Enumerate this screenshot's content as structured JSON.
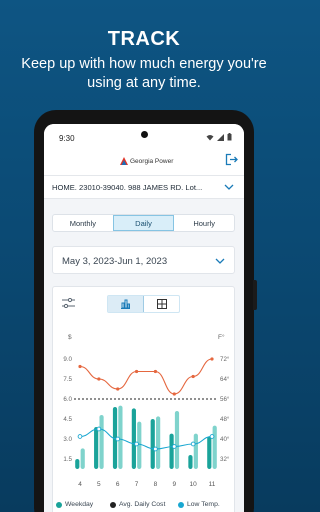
{
  "promo": {
    "title": "TRACK",
    "subtitle": "Keep up with how much energy you're using at any time."
  },
  "status_bar": {
    "time": "9:30"
  },
  "app": {
    "brand": "Georgia Power"
  },
  "account": {
    "address": "HOME. 23010-39040. 988 JAMES RD. Lot..."
  },
  "tabs": [
    {
      "label": "Monthly",
      "active": false
    },
    {
      "label": "Daily",
      "active": true
    },
    {
      "label": "Hourly",
      "active": false
    }
  ],
  "date_range": "May 3, 2023-Jun 1, 2023",
  "chart_data": {
    "type": "bar",
    "left_axis_unit": "$",
    "right_axis_unit": "F°",
    "left_ticks": [
      "9.0",
      "7.5",
      "6.0",
      "4.5",
      "3.0",
      "1.5"
    ],
    "right_ticks": [
      "72°",
      "64°",
      "56°",
      "48°",
      "40°",
      "32°"
    ],
    "ylim": [
      0.75,
      9.75
    ],
    "temp_ylim": [
      28,
      76
    ],
    "x_tick_labels": [
      "4",
      "5",
      "6",
      "7",
      "8",
      "9",
      "10",
      "11"
    ],
    "x": [
      4,
      5,
      6,
      7,
      8,
      9,
      10,
      11
    ],
    "series": [
      {
        "name": "Weekday",
        "values": [
          1.5,
          3.9,
          5.4,
          5.3,
          4.5,
          3.4,
          1.8,
          3.2
        ],
        "color": "#1aa39a"
      },
      {
        "name": "Weekday (lighter)",
        "values": [
          2.3,
          4.8,
          5.5,
          4.3,
          4.7,
          5.1,
          3.4,
          4.0
        ],
        "color": "#7fd3cc"
      }
    ],
    "avg_daily_cost": 6.0,
    "temperature_series": {
      "name": "Low Temp.",
      "values": [
        41,
        44,
        40,
        38,
        36,
        37,
        38,
        41
      ],
      "color": "#19a7d1"
    },
    "high_temp_series": {
      "values": [
        69,
        64,
        60,
        67,
        67,
        58,
        65,
        72
      ],
      "color": "#e5673f"
    }
  },
  "legend": [
    {
      "label": "Weekday",
      "color": "#1aa39a"
    },
    {
      "label": "Avg. Daily Cost",
      "color": "#222222"
    },
    {
      "label": "Low Temp.",
      "color": "#19a7d1"
    }
  ]
}
